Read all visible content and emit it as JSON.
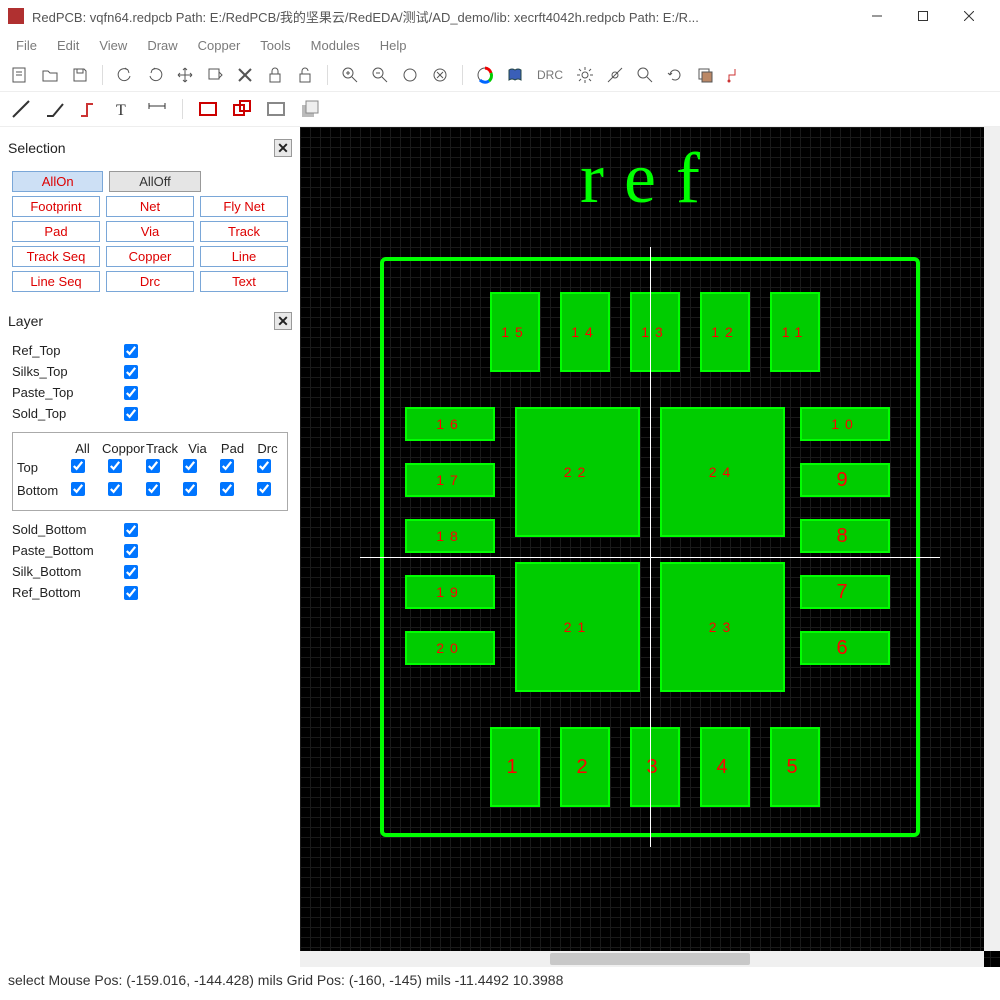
{
  "title": "RedPCB: vqfn64.redpcb Path: E:/RedPCB/我的坚果云/RedEDA/测试/AD_demo/lib: xecrft4042h.redpcb Path: E:/R...",
  "menu": {
    "file": "File",
    "edit": "Edit",
    "view": "View",
    "draw": "Draw",
    "copper": "Copper",
    "tools": "Tools",
    "modules": "Modules",
    "help": "Help"
  },
  "drc_label": "DRC",
  "selection": {
    "title": "Selection",
    "allon": "AllOn",
    "alloff": "AllOff",
    "buttons": [
      [
        "Footprint",
        "Net",
        "Fly Net"
      ],
      [
        "Pad",
        "Via",
        "Track"
      ],
      [
        "Track Seq",
        "Copper",
        "Line"
      ],
      [
        "Line Seq",
        "Drc",
        "Text"
      ]
    ]
  },
  "layer": {
    "title": "Layer",
    "top_layers": [
      "Ref_Top",
      "Silks_Top",
      "Paste_Top",
      "Sold_Top"
    ],
    "table_headers": [
      "All",
      "Coppor",
      "Track",
      "Via",
      "Pad",
      "Drc"
    ],
    "table_rows": [
      "Top",
      "Bottom"
    ],
    "bottom_layers": [
      "Sold_Bottom",
      "Paste_Bottom",
      "Silk_Bottom",
      "Ref_Bottom"
    ]
  },
  "canvas": {
    "ref_text": "ref",
    "pads_top": [
      {
        "n": "15"
      },
      {
        "n": "14"
      },
      {
        "n": "13"
      },
      {
        "n": "12"
      },
      {
        "n": "11"
      }
    ],
    "pads_bottom": [
      {
        "n": "1"
      },
      {
        "n": "2"
      },
      {
        "n": "3"
      },
      {
        "n": "4"
      },
      {
        "n": "5"
      }
    ],
    "pads_left": [
      {
        "n": "16"
      },
      {
        "n": "17"
      },
      {
        "n": "18"
      },
      {
        "n": "19"
      },
      {
        "n": "20"
      }
    ],
    "pads_right": [
      {
        "n": "10"
      },
      {
        "n": "9"
      },
      {
        "n": "8"
      },
      {
        "n": "7"
      },
      {
        "n": "6"
      }
    ],
    "pads_center": [
      {
        "n": "22"
      },
      {
        "n": "24"
      },
      {
        "n": "21"
      },
      {
        "n": "23"
      }
    ]
  },
  "status": "select   Mouse Pos: (-159.016, -144.428) mils Grid Pos: (-160, -145) mils -11.4492 10.3988"
}
